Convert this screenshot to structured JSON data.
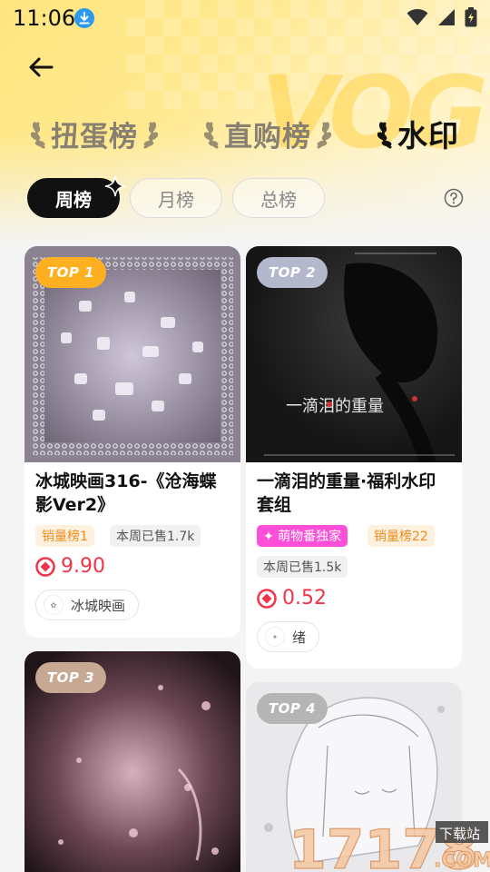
{
  "status_bar": {
    "time": "11:06"
  },
  "rank_tabs": [
    {
      "label": "扭蛋榜",
      "active": false
    },
    {
      "label": "直购榜",
      "active": false
    },
    {
      "label": "水印",
      "active": true
    }
  ],
  "period_tabs": [
    {
      "label": "周榜",
      "active": true
    },
    {
      "label": "月榜",
      "active": false
    },
    {
      "label": "总榜",
      "active": false
    }
  ],
  "cards": [
    {
      "badge": "TOP 1",
      "title_line1": "冰城映画316-《沧海蝶",
      "title_line2": "影Ver2》",
      "tags": [
        "销量榜1",
        "本周已售1.7k"
      ],
      "price": "9.90",
      "shop": "冰城映画"
    },
    {
      "badge": "TOP 2",
      "title_line1": "一滴泪的重量·福利水印",
      "title_line2": "套组",
      "tags": [
        "✦ 萌物番独家",
        "销量榜22",
        "本周已售1.5k"
      ],
      "price": "0.52",
      "shop": "绪",
      "image_text": "一滴泪的重量"
    },
    {
      "badge": "TOP 3"
    },
    {
      "badge": "TOP 4"
    }
  ],
  "colors": {
    "badge_top1": "#ffb020",
    "badge_top2": "#b3b8cc",
    "badge_top3": "#c7a892",
    "badge_top4": "#b5b5b5",
    "price": "#f0344a",
    "rank_tag_text": "#f08a18",
    "exclusive_tag": "#ff4fd8"
  },
  "watermark": {
    "site": "17178",
    "sub": "下载站",
    "domain": ".COM"
  }
}
